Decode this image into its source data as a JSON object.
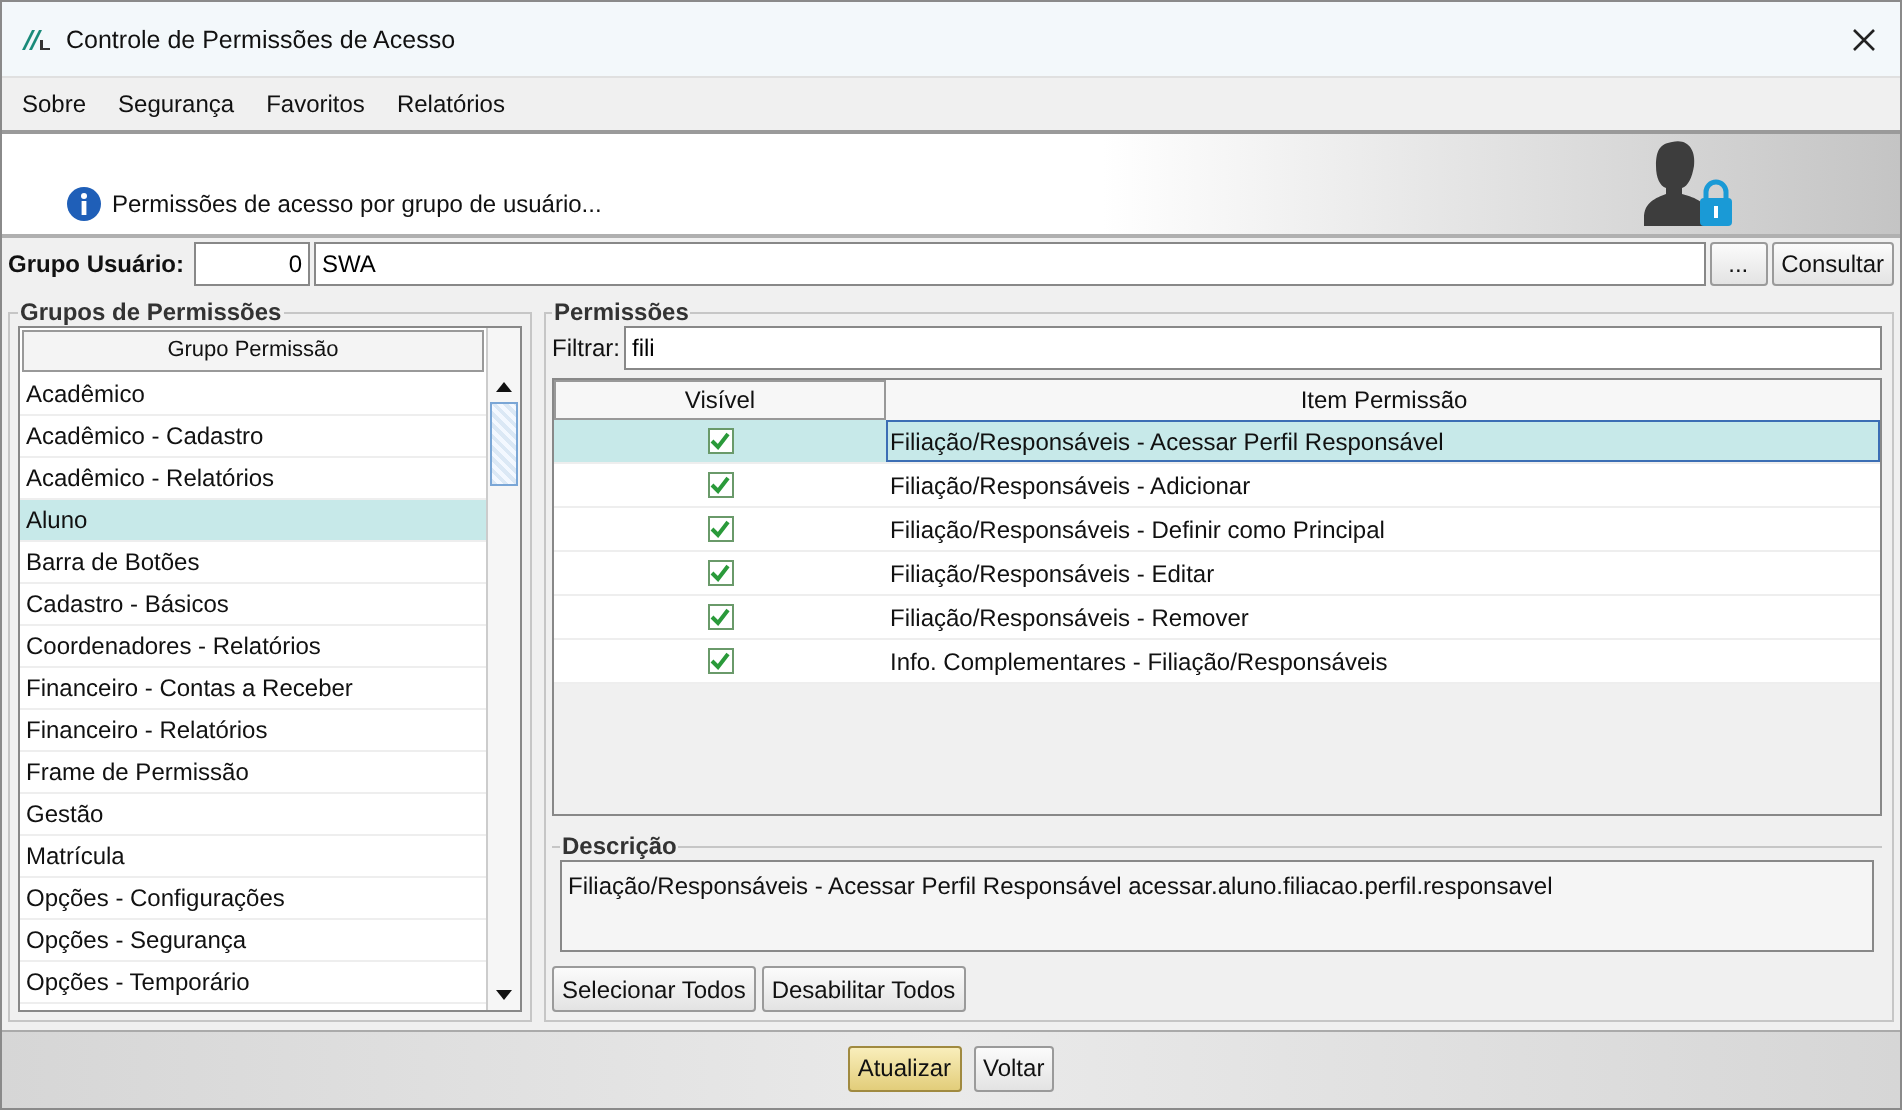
{
  "window": {
    "title": "Controle de Permissões de Acesso"
  },
  "menu": [
    {
      "label": "Sobre"
    },
    {
      "label": "Segurança"
    },
    {
      "label": "Favoritos"
    },
    {
      "label": "Relatórios"
    }
  ],
  "banner": {
    "text": "Permissões de acesso por grupo de usuário..."
  },
  "user_group": {
    "label": "Grupo Usuário:",
    "code": "0",
    "name": "SWA",
    "browse_button": "...",
    "search_button": "Consultar"
  },
  "groups": {
    "title": "Grupos de Permissões",
    "column": "Grupo Permissão",
    "items": [
      {
        "label": "Acadêmico",
        "selected": false
      },
      {
        "label": "Acadêmico - Cadastro",
        "selected": false
      },
      {
        "label": "Acadêmico - Relatórios",
        "selected": false
      },
      {
        "label": "Aluno",
        "selected": true
      },
      {
        "label": "Barra de Botões",
        "selected": false
      },
      {
        "label": "Cadastro - Básicos",
        "selected": false
      },
      {
        "label": "Coordenadores - Relatórios",
        "selected": false
      },
      {
        "label": "Financeiro - Contas a Receber",
        "selected": false
      },
      {
        "label": "Financeiro - Relatórios",
        "selected": false
      },
      {
        "label": "Frame de Permissão",
        "selected": false
      },
      {
        "label": "Gestão",
        "selected": false
      },
      {
        "label": "Matrícula",
        "selected": false
      },
      {
        "label": "Opções - Configurações",
        "selected": false
      },
      {
        "label": "Opções - Segurança",
        "selected": false
      },
      {
        "label": "Opções - Temporário",
        "selected": false
      }
    ]
  },
  "permissions": {
    "title": "Permissões",
    "filter": {
      "label": "Filtrar:",
      "value": "fili"
    },
    "columns": [
      "Visível",
      "Item Permissão"
    ],
    "rows": [
      {
        "visible": true,
        "item": "Filiação/Responsáveis - Acessar Perfil Responsável",
        "selected": true
      },
      {
        "visible": true,
        "item": "Filiação/Responsáveis - Adicionar",
        "selected": false
      },
      {
        "visible": true,
        "item": "Filiação/Responsáveis - Definir como Principal",
        "selected": false
      },
      {
        "visible": true,
        "item": "Filiação/Responsáveis - Editar",
        "selected": false
      },
      {
        "visible": true,
        "item": "Filiação/Responsáveis - Remover",
        "selected": false
      },
      {
        "visible": true,
        "item": "Info. Complementares - Filiação/Responsáveis",
        "selected": false
      }
    ],
    "description": {
      "title": "Descrição",
      "text": "Filiação/Responsáveis - Acessar Perfil Responsável acessar.aluno.filiacao.perfil.responsavel"
    },
    "buttons": [
      "Selecionar Todos",
      "Desabilitar Todos"
    ]
  },
  "footer_buttons": [
    {
      "label": "Atualizar",
      "default": true
    },
    {
      "label": "Voltar",
      "default": false
    }
  ]
}
